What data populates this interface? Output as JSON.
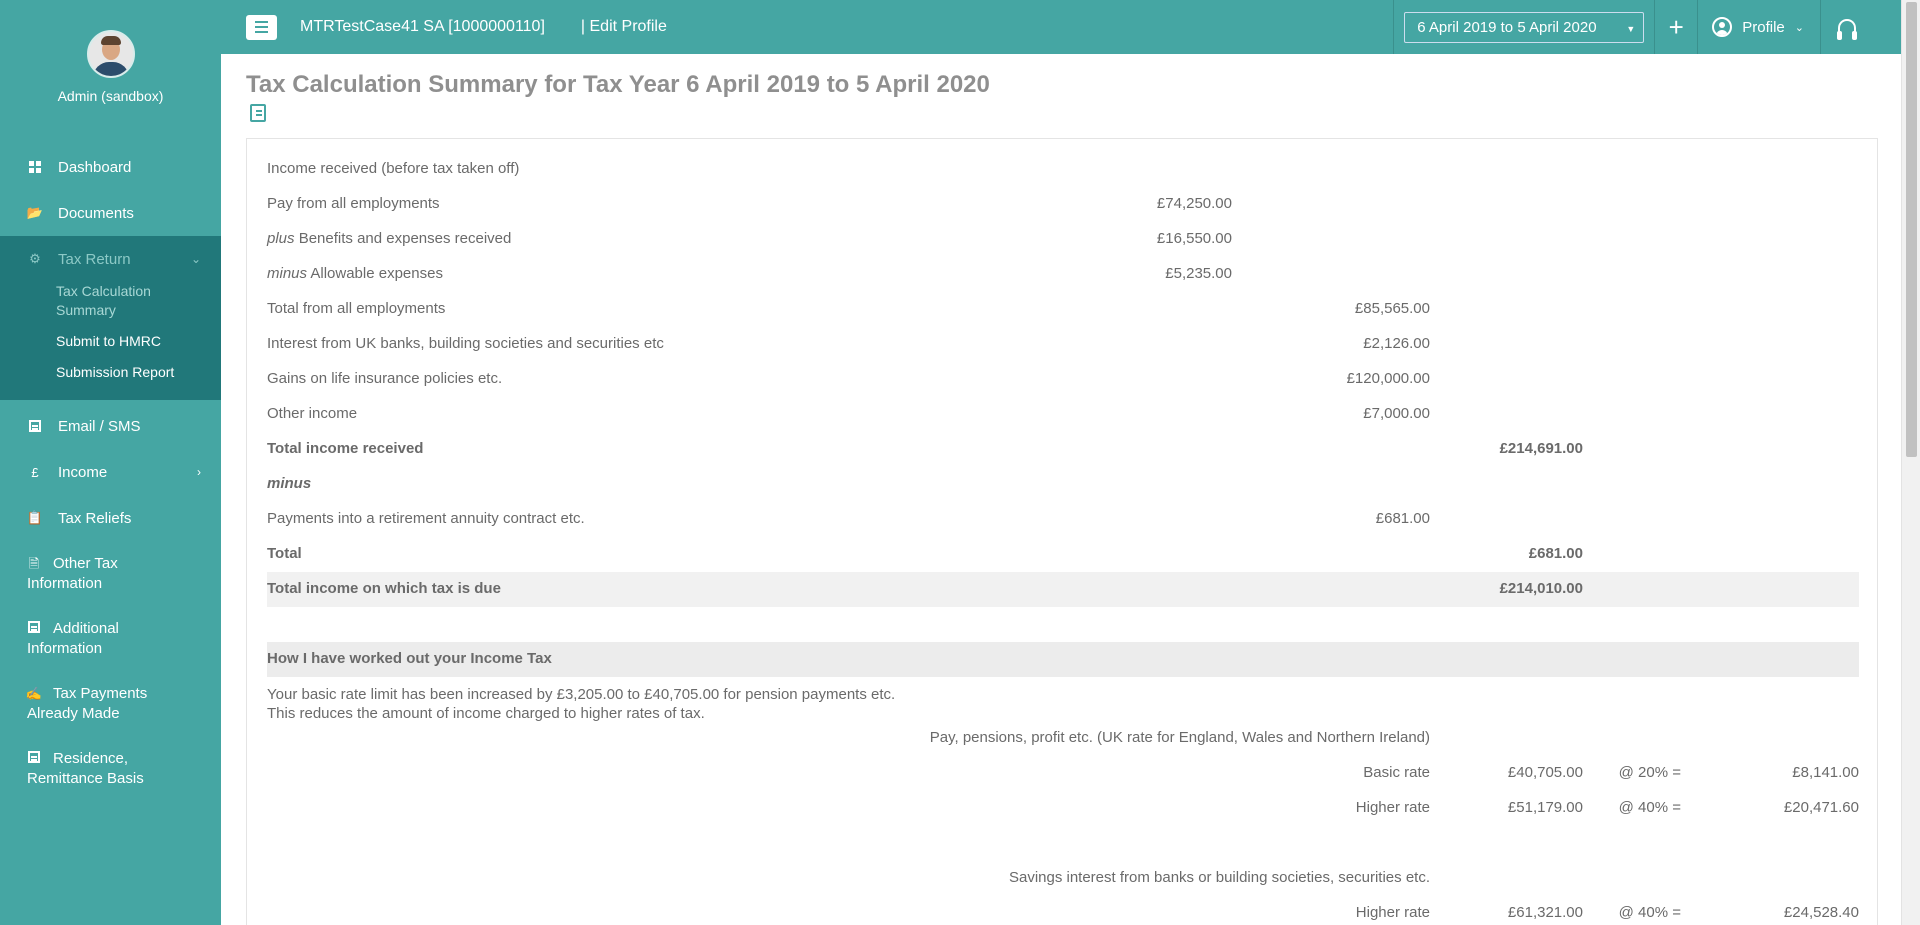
{
  "user": {
    "name": "Admin (sandbox)"
  },
  "nav": {
    "dashboard": "Dashboard",
    "documents": "Documents",
    "tax_return": "Tax Return",
    "tax_calc_summary": "Tax Calculation Summary",
    "submit_hmrc": "Submit to HMRC",
    "submission_report": "Submission Report",
    "email_sms": "Email / SMS",
    "income": "Income",
    "tax_reliefs": "Tax Reliefs",
    "other_tax": "Other Tax Information",
    "additional": "Additional Information",
    "tax_payments": "Tax Payments Already Made",
    "residence": "Residence, Remittance Basis"
  },
  "topbar": {
    "client": "MTRTestCase41 SA [1000000110]",
    "edit_profile": "| Edit Profile",
    "year": "6 April 2019 to 5 April 2020",
    "profile": "Profile"
  },
  "main": {
    "title": "Tax Calculation Summary for Tax Year 6 April 2019 to 5 April 2020",
    "income_header": "Income received (before tax taken off)",
    "rows": {
      "pay_label": "Pay from all employments",
      "pay_val": "£74,250.00",
      "benefits_prefix": "plus",
      "benefits_label": "Benefits and expenses received",
      "benefits_val": "£16,550.00",
      "allow_prefix": "minus",
      "allow_label": "Allowable expenses",
      "allow_val": "£5,235.00",
      "total_emp_label": "Total from all employments",
      "total_emp_val": "£85,565.00",
      "interest_label": "Interest from UK banks, building societies and securities etc",
      "interest_val": "£2,126.00",
      "gains_label": "Gains on life insurance policies etc.",
      "gains_val": "£120,000.00",
      "other_label": "Other income",
      "other_val": "£7,000.00",
      "total_income_label": "Total income received",
      "total_income_val": "£214,691.00",
      "minus_label": "minus",
      "retire_label": "Payments into a retirement annuity contract etc.",
      "retire_val": "£681.00",
      "total_label": "Total",
      "total_val": "£681.00",
      "taxdue_label": "Total income on which tax is due",
      "taxdue_val": "£214,010.00"
    },
    "income_tax_header": "How I have worked out your Income Tax",
    "note_line1": "Your basic rate limit has been increased by £3,205.00 to £40,705.00 for pension payments etc.",
    "note_line2": "This reduces the amount of income charged to higher rates of tax.",
    "pay_heading": "Pay, pensions, profit etc. (UK rate for England, Wales and Northern Ireland)",
    "basic": {
      "label": "Basic rate",
      "amount": "£40,705.00",
      "rate": "@ 20% =",
      "tax": "£8,141.00"
    },
    "higher": {
      "label": "Higher rate",
      "amount": "£51,179.00",
      "rate": "@ 40% =",
      "tax": "£20,471.60"
    },
    "savings_heading": "Savings interest from banks or building societies, securities etc.",
    "savings_higher": {
      "label": "Higher rate",
      "amount": "£61,321.00",
      "rate": "@ 40% =",
      "tax": "£24,528.40"
    }
  }
}
